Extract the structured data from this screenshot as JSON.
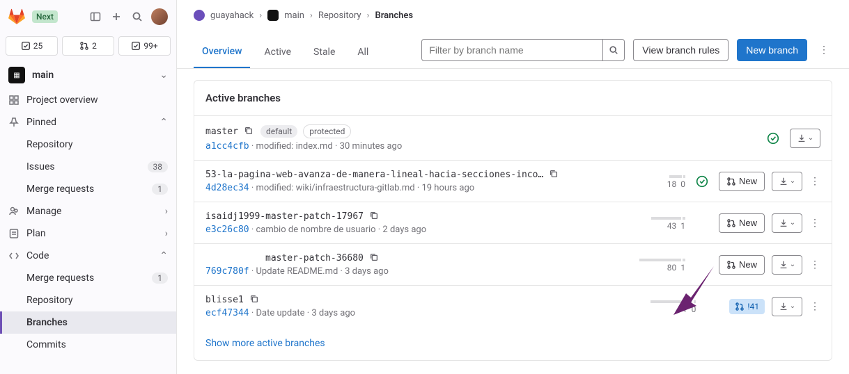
{
  "top": {
    "next_label": "Next",
    "stats": {
      "todos": "25",
      "mrs": "2",
      "issues": "99+"
    }
  },
  "project_name": "main",
  "sidebar": {
    "overview": "Project overview",
    "pinned": "Pinned",
    "pins": [
      {
        "label": "Repository"
      },
      {
        "label": "Issues",
        "badge": "38"
      },
      {
        "label": "Merge requests",
        "badge": "1"
      }
    ],
    "manage": "Manage",
    "plan": "Plan",
    "code": "Code",
    "code_items": [
      {
        "label": "Merge requests",
        "badge": "1"
      },
      {
        "label": "Repository"
      },
      {
        "label": "Branches",
        "active": true
      },
      {
        "label": "Commits"
      }
    ]
  },
  "breadcrumbs": {
    "group": "guayahack",
    "project": "main",
    "repo": "Repository",
    "page": "Branches"
  },
  "tabs": {
    "overview": "Overview",
    "active": "Active",
    "stale": "Stale",
    "all": "All"
  },
  "controls": {
    "search_placeholder": "Filter by branch name",
    "view_rules": "View branch rules",
    "new_branch": "New branch"
  },
  "panel": {
    "title": "Active branches",
    "branches": [
      {
        "name": "master",
        "badges": [
          "default",
          "protected"
        ],
        "sha": "a1cc4cfb",
        "message": "modified: index.md",
        "time": "30 minutes ago",
        "behind": "",
        "ahead": "",
        "status": "success",
        "actions": {
          "download": true
        }
      },
      {
        "name": "53-la-pagina-web-avanza-de-manera-lineal-hacia-secciones-inco…",
        "sha": "4d28ec34",
        "message": "modified: wiki/infraestructura-gitlab.md",
        "time": "19 hours ago",
        "behind": "18",
        "ahead": "0",
        "status": "success",
        "actions": {
          "new_mr": "New",
          "download": true,
          "kebab": true
        }
      },
      {
        "name": "isaidj1999-master-patch-17967",
        "sha": "e3c26c80",
        "message": "cambio de nombre de usuario",
        "time": "2 days ago",
        "behind": "43",
        "ahead": "1",
        "actions": {
          "new_mr": "New",
          "download": true,
          "kebab": true
        }
      },
      {
        "name": "master-patch-36680",
        "indented": true,
        "sha": "769c780f",
        "message": "Update README.md",
        "time": "3 days ago",
        "behind": "80",
        "ahead": "1",
        "actions": {
          "new_mr": "New",
          "download": true,
          "kebab": true
        }
      },
      {
        "name": "blisse1",
        "sha": "ecf47344",
        "message": "Date update",
        "time": "3 days ago",
        "behind": "91",
        "ahead": "0",
        "actions": {
          "mr_link": "!41",
          "download": true,
          "kebab": true
        }
      }
    ],
    "show_more": "Show more active branches"
  }
}
